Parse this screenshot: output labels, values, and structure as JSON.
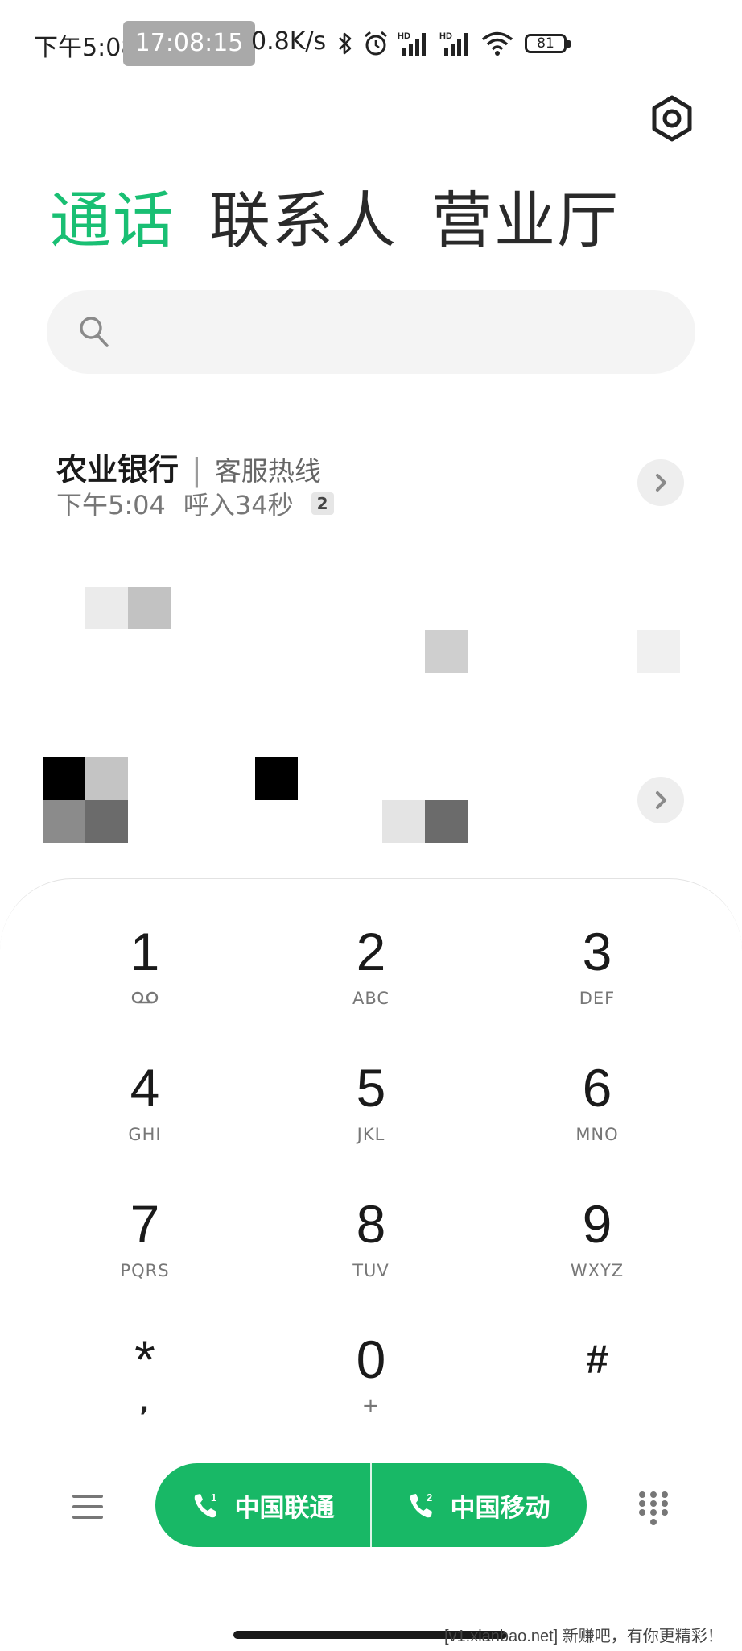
{
  "status_bar": {
    "time": "下午5:08",
    "clock_overlay": "17:08:15",
    "net_speed": "0.8K/s",
    "battery": "81"
  },
  "tabs": [
    {
      "label": "通话",
      "active": true
    },
    {
      "label": "联系人",
      "active": false
    },
    {
      "label": "营业厅",
      "active": false
    }
  ],
  "search": {
    "placeholder": "",
    "value": ""
  },
  "call_log": [
    {
      "name": "农业银行",
      "tag": "客服热线",
      "time": "下午5:04",
      "detail": "呼入34秒",
      "count": "2"
    }
  ],
  "dialpad": {
    "keys": [
      {
        "digit": "1",
        "letters": ""
      },
      {
        "digit": "2",
        "letters": "ABC"
      },
      {
        "digit": "3",
        "letters": "DEF"
      },
      {
        "digit": "4",
        "letters": "GHI"
      },
      {
        "digit": "5",
        "letters": "JKL"
      },
      {
        "digit": "6",
        "letters": "MNO"
      },
      {
        "digit": "7",
        "letters": "PQRS"
      },
      {
        "digit": "8",
        "letters": "TUV"
      },
      {
        "digit": "9",
        "letters": "WXYZ"
      },
      {
        "digit": "*",
        "letters": ","
      },
      {
        "digit": "0",
        "letters": "+"
      },
      {
        "digit": "#",
        "letters": ""
      }
    ]
  },
  "call_buttons": {
    "sim1_label": "中国联通",
    "sim1_index": "1",
    "sim2_label": "中国移动",
    "sim2_index": "2",
    "color": "#18b866"
  },
  "accent_color": "#19bf73",
  "icons": {
    "settings": "gear-icon",
    "search": "search-icon",
    "menu": "menu-icon",
    "keypad": "keypad-icon",
    "voicemail": "voicemail-icon"
  },
  "watermark": "[v1.xianbao.net] 新赚吧，有你更精彩！"
}
